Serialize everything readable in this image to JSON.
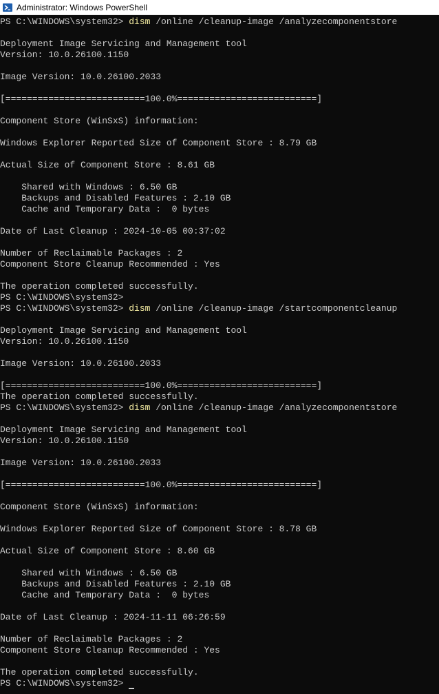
{
  "window": {
    "title": "Administrator: Windows PowerShell",
    "icon": "powershell-icon"
  },
  "colors": {
    "background": "#0c0c0c",
    "text": "#cccccc",
    "command": "#f9f1a5"
  },
  "console": {
    "lines": [
      {
        "type": "cmd",
        "prompt": "PS C:\\WINDOWS\\system32> ",
        "command": "dism",
        "args": " /online /cleanup-image /analyzecomponentstore"
      },
      {
        "type": "text",
        "text": ""
      },
      {
        "type": "text",
        "text": "Deployment Image Servicing and Management tool"
      },
      {
        "type": "text",
        "text": "Version: 10.0.26100.1150"
      },
      {
        "type": "text",
        "text": ""
      },
      {
        "type": "text",
        "text": "Image Version: 10.0.26100.2033"
      },
      {
        "type": "text",
        "text": ""
      },
      {
        "type": "text",
        "text": "[==========================100.0%==========================]"
      },
      {
        "type": "text",
        "text": ""
      },
      {
        "type": "text",
        "text": "Component Store (WinSxS) information:"
      },
      {
        "type": "text",
        "text": ""
      },
      {
        "type": "text",
        "text": "Windows Explorer Reported Size of Component Store : 8.79 GB"
      },
      {
        "type": "text",
        "text": ""
      },
      {
        "type": "text",
        "text": "Actual Size of Component Store : 8.61 GB"
      },
      {
        "type": "text",
        "text": ""
      },
      {
        "type": "text",
        "text": "    Shared with Windows : 6.50 GB"
      },
      {
        "type": "text",
        "text": "    Backups and Disabled Features : 2.10 GB"
      },
      {
        "type": "text",
        "text": "    Cache and Temporary Data :  0 bytes"
      },
      {
        "type": "text",
        "text": ""
      },
      {
        "type": "text",
        "text": "Date of Last Cleanup : 2024-10-05 00:37:02"
      },
      {
        "type": "text",
        "text": ""
      },
      {
        "type": "text",
        "text": "Number of Reclaimable Packages : 2"
      },
      {
        "type": "text",
        "text": "Component Store Cleanup Recommended : Yes"
      },
      {
        "type": "text",
        "text": ""
      },
      {
        "type": "text",
        "text": "The operation completed successfully."
      },
      {
        "type": "prompt",
        "prompt": "PS C:\\WINDOWS\\system32>"
      },
      {
        "type": "cmd",
        "prompt": "PS C:\\WINDOWS\\system32> ",
        "command": "dism",
        "args": " /online /cleanup-image /startcomponentcleanup"
      },
      {
        "type": "text",
        "text": ""
      },
      {
        "type": "text",
        "text": "Deployment Image Servicing and Management tool"
      },
      {
        "type": "text",
        "text": "Version: 10.0.26100.1150"
      },
      {
        "type": "text",
        "text": ""
      },
      {
        "type": "text",
        "text": "Image Version: 10.0.26100.2033"
      },
      {
        "type": "text",
        "text": ""
      },
      {
        "type": "text",
        "text": "[==========================100.0%==========================]"
      },
      {
        "type": "text",
        "text": "The operation completed successfully."
      },
      {
        "type": "cmd",
        "prompt": "PS C:\\WINDOWS\\system32> ",
        "command": "dism",
        "args": " /online /cleanup-image /analyzecomponentstore"
      },
      {
        "type": "text",
        "text": ""
      },
      {
        "type": "text",
        "text": "Deployment Image Servicing and Management tool"
      },
      {
        "type": "text",
        "text": "Version: 10.0.26100.1150"
      },
      {
        "type": "text",
        "text": ""
      },
      {
        "type": "text",
        "text": "Image Version: 10.0.26100.2033"
      },
      {
        "type": "text",
        "text": ""
      },
      {
        "type": "text",
        "text": "[==========================100.0%==========================]"
      },
      {
        "type": "text",
        "text": ""
      },
      {
        "type": "text",
        "text": "Component Store (WinSxS) information:"
      },
      {
        "type": "text",
        "text": ""
      },
      {
        "type": "text",
        "text": "Windows Explorer Reported Size of Component Store : 8.78 GB"
      },
      {
        "type": "text",
        "text": ""
      },
      {
        "type": "text",
        "text": "Actual Size of Component Store : 8.60 GB"
      },
      {
        "type": "text",
        "text": ""
      },
      {
        "type": "text",
        "text": "    Shared with Windows : 6.50 GB"
      },
      {
        "type": "text",
        "text": "    Backups and Disabled Features : 2.10 GB"
      },
      {
        "type": "text",
        "text": "    Cache and Temporary Data :  0 bytes"
      },
      {
        "type": "text",
        "text": ""
      },
      {
        "type": "text",
        "text": "Date of Last Cleanup : 2024-11-11 06:26:59"
      },
      {
        "type": "text",
        "text": ""
      },
      {
        "type": "text",
        "text": "Number of Reclaimable Packages : 2"
      },
      {
        "type": "text",
        "text": "Component Store Cleanup Recommended : Yes"
      },
      {
        "type": "text",
        "text": ""
      },
      {
        "type": "text",
        "text": "The operation completed successfully."
      },
      {
        "type": "prompt",
        "prompt": "PS C:\\WINDOWS\\system32>",
        "cursor": true
      }
    ]
  }
}
